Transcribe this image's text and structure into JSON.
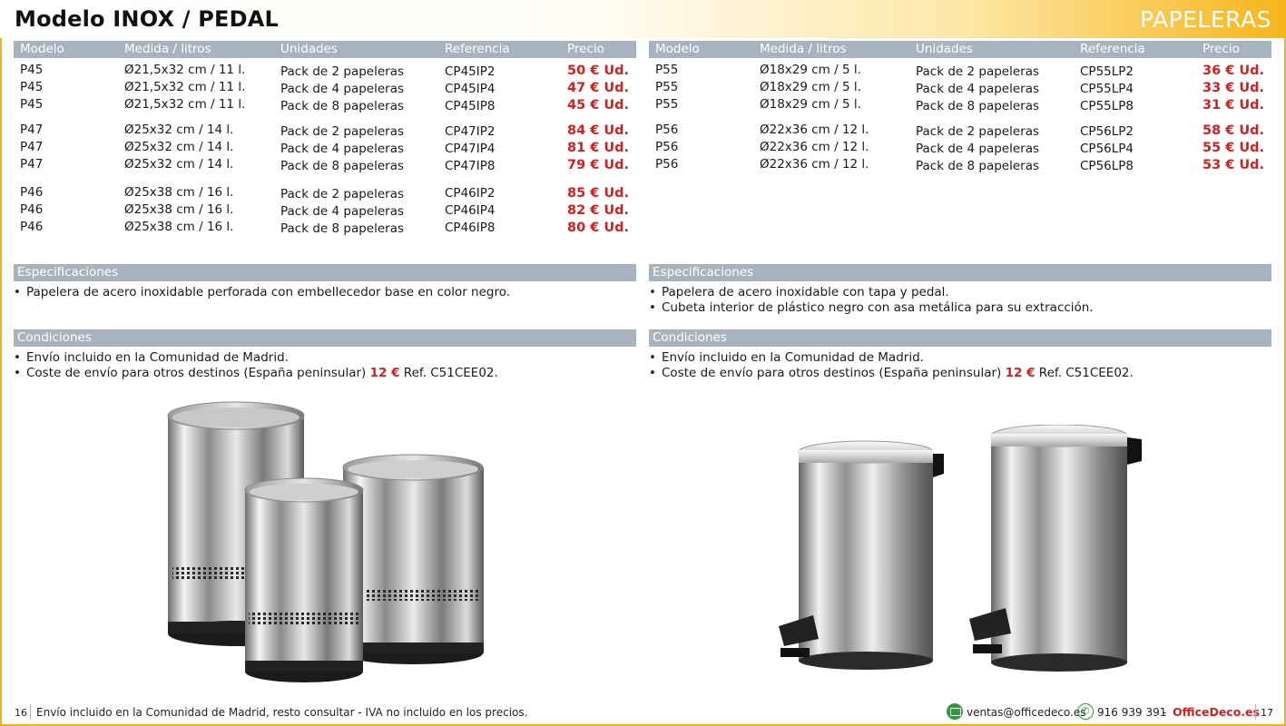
{
  "header": {
    "title": "Modelo INOX / PEDAL",
    "section": "PAPELERAS"
  },
  "table_headers": [
    "Modelo",
    "Medida / litros",
    "Unidades",
    "Referencia",
    "Precio"
  ],
  "left": {
    "rows": [
      [
        "P45",
        "Ø21,5x32 cm / 11 l.",
        "Pack de 2 papeleras",
        "CP45IP2",
        "50 € Ud."
      ],
      [
        "P45",
        "Ø21,5x32 cm / 11 l.",
        "Pack de 4 papeleras",
        "CP45IP4",
        "47 € Ud."
      ],
      [
        "P45",
        "Ø21,5x32 cm / 11 l.",
        "Pack de 8 papeleras",
        "CP45IP8",
        "45 € Ud."
      ],
      [
        "P47",
        "Ø25x32 cm / 14 l.",
        "Pack de 2 papeleras",
        "CP47IP2",
        "84 € Ud."
      ],
      [
        "P47",
        "Ø25x32 cm / 14 l.",
        "Pack de 4 papeleras",
        "CP47IP4",
        "81 € Ud."
      ],
      [
        "P47",
        "Ø25x32 cm / 14 l.",
        "Pack de 8 papeleras",
        "CP47IP8",
        "79 € Ud."
      ],
      [
        "P46",
        "Ø25x38 cm / 16 l.",
        "Pack de 2 papeleras",
        "CP46IP2",
        "85 € Ud."
      ],
      [
        "P46",
        "Ø25x38 cm / 16 l.",
        "Pack de 4 papeleras",
        "CP46IP4",
        "82 € Ud."
      ],
      [
        "P46",
        "Ø25x38 cm / 16 l.",
        "Pack de 8 papeleras",
        "CP46IP8",
        "80 € Ud."
      ]
    ],
    "spec_title": "Especificaciones",
    "specs": [
      "Papelera de acero inoxidable perforada con embellecedor base en color negro."
    ],
    "cond_title": "Condiciones",
    "cond_1": "Envío incluido en la Comunidad de Madrid.",
    "cond_2_pre": "Coste de envío para otros destinos (España peninsular)",
    "cond_2_price": "12 €",
    "cond_2_post": "Ref. C51CEE02."
  },
  "right": {
    "rows": [
      [
        "P55",
        "Ø18x29 cm / 5 l.",
        "Pack de 2 papeleras",
        "CP55LP2",
        "36 € Ud."
      ],
      [
        "P55",
        "Ø18x29 cm / 5 l.",
        "Pack de 4 papeleras",
        "CP55LP4",
        "33 € Ud."
      ],
      [
        "P55",
        "Ø18x29 cm / 5 l.",
        "Pack de 8 papeleras",
        "CP55LP8",
        "31 € Ud."
      ],
      [
        "P56",
        "Ø22x36 cm / 12 l.",
        "Pack de 2 papeleras",
        "CP56LP2",
        "58 € Ud."
      ],
      [
        "P56",
        "Ø22x36 cm / 12 l.",
        "Pack de 4 papeleras",
        "CP56LP4",
        "55 € Ud."
      ],
      [
        "P56",
        "Ø22x36 cm / 12 l.",
        "Pack de 8 papeleras",
        "CP56LP8",
        "53 € Ud."
      ]
    ],
    "spec_title": "Especificaciones",
    "specs": [
      "Papelera de acero inoxidable con tapa y pedal.",
      "Cubeta interior de plástico negro con asa metálica para su extracción."
    ],
    "cond_title": "Condiciones",
    "cond_1": "Envío incluido en la Comunidad de Madrid.",
    "cond_2_pre": "Coste de envío para otros destinos (España peninsular)",
    "cond_2_price": "12 €",
    "cond_2_post": "Ref. C51CEE02."
  },
  "footer": {
    "page_left": "16",
    "note": "Envío incluido en la Comunidad de Madrid, resto consultar - IVA no incluido en los precios.",
    "email": "ventas@officedeco.es",
    "phone": "916 939 391",
    "dash": "-",
    "brand": "OfficeDeco.es",
    "page_right": "17"
  },
  "colors": {
    "accent": "#f2b31a",
    "price": "#d21f1f",
    "bar": "#a7b3bf",
    "icon_green": "#2f9a3a"
  },
  "icons": [
    "email-icon",
    "phone-icon",
    "bullet-icon"
  ]
}
